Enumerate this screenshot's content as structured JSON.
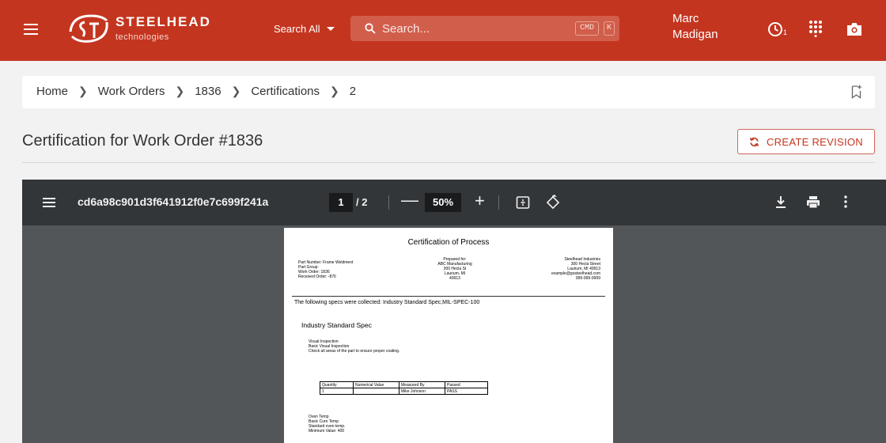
{
  "brand": {
    "name": "STEELHEAD",
    "sub": "technologies",
    "accent": "#c4351f"
  },
  "header": {
    "search_scope": "Search All",
    "search_placeholder": "Search...",
    "shortcut_cmd": "CMD",
    "shortcut_key": "K",
    "user_name": "Marc Madigan",
    "clock_badge": "1",
    "icons": [
      "menu-icon",
      "search-icon",
      "clock-icon",
      "apps-grid-icon",
      "camera-icon"
    ]
  },
  "breadcrumb": [
    "Home",
    "Work Orders",
    "1836",
    "Certifications",
    "2"
  ],
  "page": {
    "title": "Certification for Work Order #1836",
    "create_revision_label": "CREATE REVISION"
  },
  "viewer": {
    "doc_name": "cd6a98c901d3f641912f0e7c699f241a",
    "current_page": "1",
    "total_pages": "/ 2",
    "zoom": "50%",
    "zoom_out": "—",
    "zoom_in": "+"
  },
  "document": {
    "title": "Certification of Process",
    "left_info": [
      "Part Number: Frame Weldment",
      "Part Group:",
      "Work Order: 1836",
      "Received Order: -876"
    ],
    "prepared_for": [
      "Prepared for:",
      "ABC Manufacturing",
      "300 Hecla St",
      "Laurium, MI",
      "49913"
    ],
    "company": [
      "Steelhead Industries",
      "300 Hecla Street",
      "Laurium, MI 49913",
      "example@gosteelhead.com",
      "999-999-9999"
    ],
    "specs_line": "The following specs were collected: Industry Standard Spec,MIL-SPEC-100",
    "spec_heading": "Industry Standard Spec",
    "inspection": [
      "Visual Inspection",
      "Basic Visual Inspection",
      "Check all areas of the part to ensure proper coating."
    ],
    "table_headers": [
      "Quantity",
      "Numerical Value",
      "Measured By",
      "Passed"
    ],
    "table_row": [
      "1",
      "",
      "Mike Johnson",
      "PASS"
    ],
    "oven": [
      "Oven Temp",
      "Basic Cure Temp",
      "Standard oven temp.",
      "Minimum Value: 400"
    ]
  }
}
